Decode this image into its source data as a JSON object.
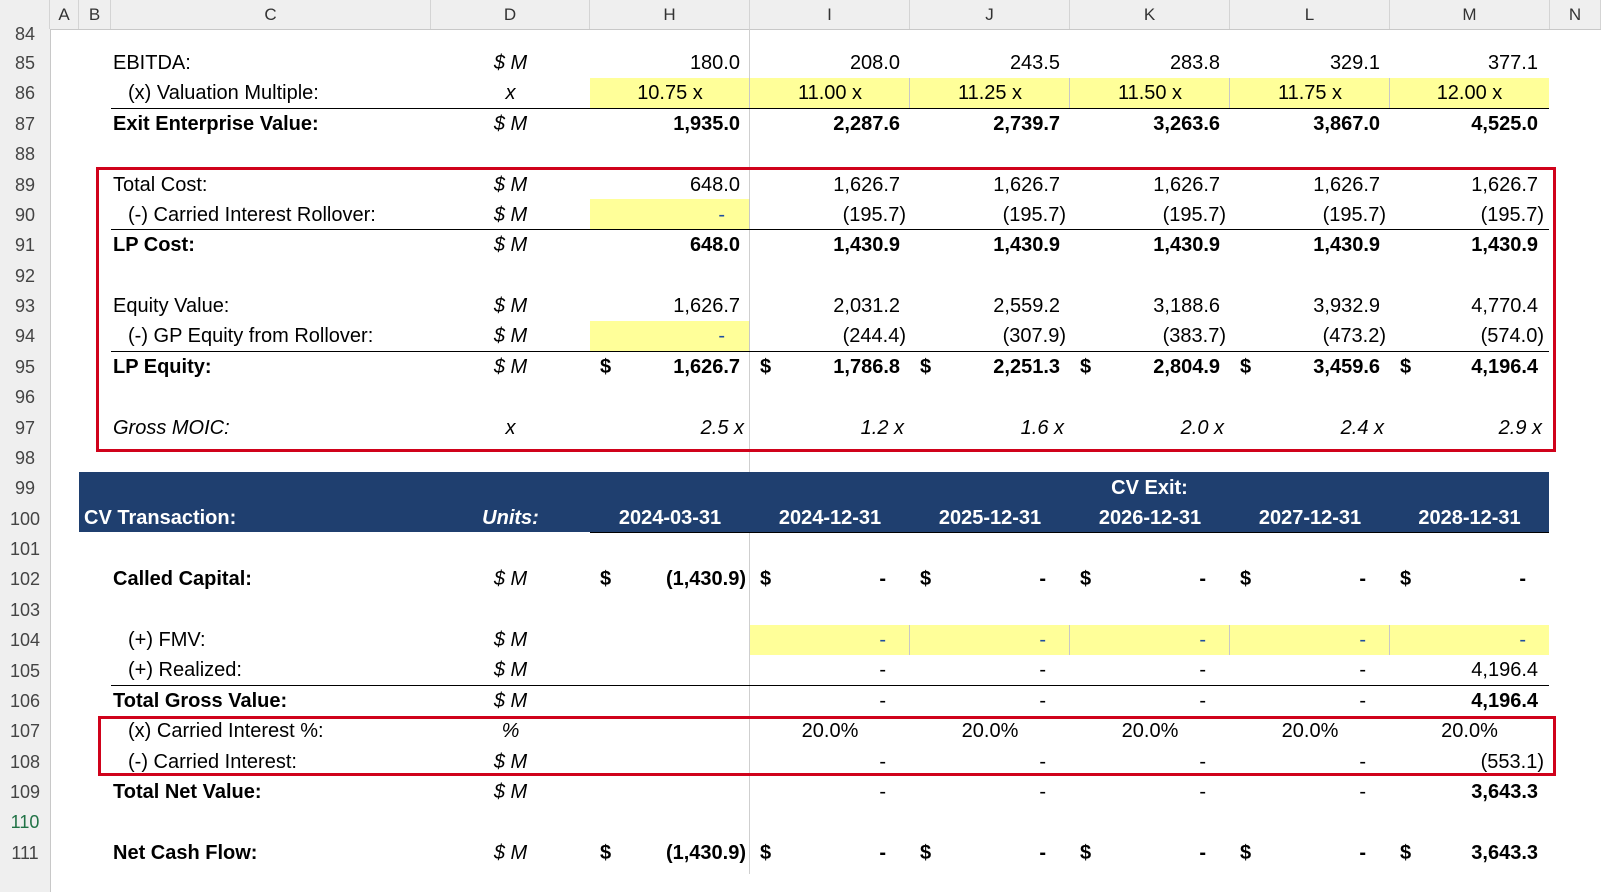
{
  "columns": [
    "A",
    "B",
    "C",
    "D",
    "H",
    "I",
    "J",
    "K",
    "L",
    "M",
    "N"
  ],
  "rows": [
    "84",
    "85",
    "86",
    "87",
    "88",
    "89",
    "90",
    "91",
    "92",
    "93",
    "94",
    "95",
    "96",
    "97",
    "98",
    "99",
    "100",
    "101",
    "102",
    "103",
    "104",
    "105",
    "106",
    "107",
    "108",
    "109",
    "110",
    "111"
  ],
  "ebitda": {
    "label": "EBITDA:",
    "unit": "$ M",
    "values": [
      "180.0",
      "208.0",
      "243.5",
      "283.8",
      "329.1",
      "377.1"
    ]
  },
  "valuation_multiple": {
    "label": "(x) Valuation Multiple:",
    "unit": "x",
    "values": [
      "10.75 x",
      "11.00 x",
      "11.25 x",
      "11.50 x",
      "11.75 x",
      "12.00 x"
    ]
  },
  "exit_ev": {
    "label": "Exit Enterprise Value:",
    "unit": "$ M",
    "values": [
      "1,935.0",
      "2,287.6",
      "2,739.7",
      "3,263.6",
      "3,867.0",
      "4,525.0"
    ]
  },
  "total_cost": {
    "label": "Total Cost:",
    "unit": "$ M",
    "values": [
      "648.0",
      "1,626.7",
      "1,626.7",
      "1,626.7",
      "1,626.7",
      "1,626.7"
    ]
  },
  "carried_rollover": {
    "label": "(-) Carried Interest Rollover:",
    "unit": "$ M",
    "values": [
      "-",
      "(195.7)",
      "(195.7)",
      "(195.7)",
      "(195.7)",
      "(195.7)"
    ]
  },
  "lp_cost": {
    "label": "LP Cost:",
    "unit": "$ M",
    "values": [
      "648.0",
      "1,430.9",
      "1,430.9",
      "1,430.9",
      "1,430.9",
      "1,430.9"
    ]
  },
  "equity_value": {
    "label": "Equity Value:",
    "unit": "$ M",
    "values": [
      "1,626.7",
      "2,031.2",
      "2,559.2",
      "3,188.6",
      "3,932.9",
      "4,770.4"
    ]
  },
  "gp_equity": {
    "label": "(-) GP Equity from Rollover:",
    "unit": "$ M",
    "values": [
      "-",
      "(244.4)",
      "(307.9)",
      "(383.7)",
      "(473.2)",
      "(574.0)"
    ]
  },
  "lp_equity": {
    "label": "LP Equity:",
    "unit": "$ M",
    "currency": "$",
    "values": [
      "1,626.7",
      "1,786.8",
      "2,251.3",
      "2,804.9",
      "3,459.6",
      "4,196.4"
    ]
  },
  "gross_moic": {
    "label": "Gross MOIC:",
    "unit": "x",
    "values": [
      "2.5 x",
      "1.2 x",
      "1.6 x",
      "2.0 x",
      "2.4 x",
      "2.9 x"
    ]
  },
  "cv_header": {
    "title": "CV Transaction:",
    "units": "Units:",
    "exit_label": "CV Exit:",
    "dates": [
      "2024-03-31",
      "2024-12-31",
      "2025-12-31",
      "2026-12-31",
      "2027-12-31",
      "2028-12-31"
    ]
  },
  "called_capital": {
    "label": "Called Capital:",
    "unit": "$ M",
    "currency": "$",
    "values": [
      "(1,430.9)",
      "-",
      "-",
      "-",
      "-",
      "-"
    ]
  },
  "fmv": {
    "label": "(+) FMV:",
    "unit": "$ M",
    "values": [
      "-",
      "-",
      "-",
      "-",
      "-"
    ]
  },
  "realized": {
    "label": "(+) Realized:",
    "unit": "$ M",
    "values": [
      "-",
      "-",
      "-",
      "-",
      "4,196.4"
    ]
  },
  "total_gross": {
    "label": "Total Gross Value:",
    "unit": "$ M",
    "values": [
      "-",
      "-",
      "-",
      "-",
      "4,196.4"
    ]
  },
  "carry_pct": {
    "label": "(x) Carried Interest %:",
    "unit": "%",
    "values": [
      "20.0%",
      "20.0%",
      "20.0%",
      "20.0%",
      "20.0%"
    ]
  },
  "carry": {
    "label": "(-) Carried Interest:",
    "unit": "$ M",
    "values": [
      "-",
      "-",
      "-",
      "-",
      "(553.1)"
    ]
  },
  "total_net": {
    "label": "Total Net Value:",
    "unit": "$ M",
    "values": [
      "-",
      "-",
      "-",
      "-",
      "3,643.3"
    ]
  },
  "net_cf": {
    "label": "Net Cash Flow:",
    "unit": "$ M",
    "currency": "$",
    "values": [
      "(1,430.9)",
      "-",
      "-",
      "-",
      "-",
      "3,643.3"
    ]
  }
}
